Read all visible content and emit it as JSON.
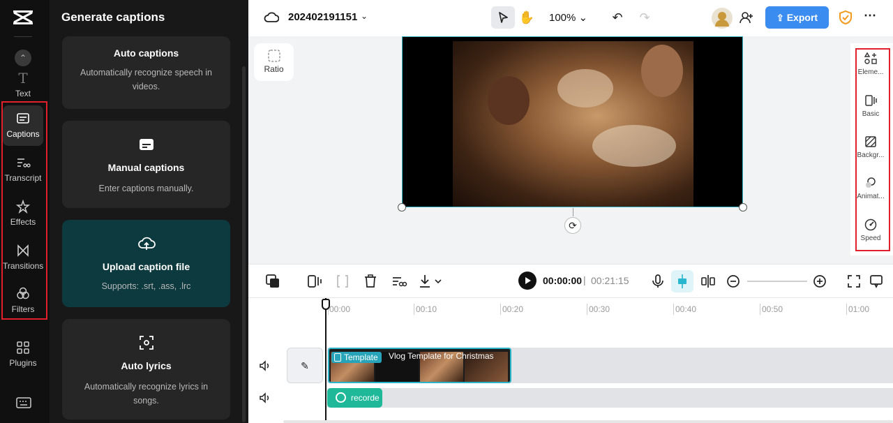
{
  "left_rail": {
    "items": [
      {
        "label": "Text"
      },
      {
        "label": "Captions"
      },
      {
        "label": "Transcript"
      },
      {
        "label": "Effects"
      },
      {
        "label": "Transitions"
      },
      {
        "label": "Filters"
      },
      {
        "label": "Plugins"
      }
    ]
  },
  "panel": {
    "title": "Generate captions",
    "cards": [
      {
        "title": "Auto captions",
        "desc": "Automatically recognize speech in videos."
      },
      {
        "title": "Manual captions",
        "desc": "Enter captions manually."
      },
      {
        "title": "Upload caption file",
        "desc": "Supports: .srt, .ass, .lrc"
      },
      {
        "title": "Auto lyrics",
        "desc": "Automatically recognize lyrics in songs."
      }
    ]
  },
  "topbar": {
    "project_name": "202402191151",
    "zoom": "100%",
    "export_label": "Export",
    "accent_color": "#3a8cf0"
  },
  "canvas": {
    "ratio_label": "Ratio"
  },
  "props": {
    "items": [
      {
        "label": "Eleme...",
        "icon": "elements-icon"
      },
      {
        "label": "Basic",
        "icon": "basic-icon"
      },
      {
        "label": "Backgr...",
        "icon": "background-icon"
      },
      {
        "label": "Animat...",
        "icon": "animation-icon"
      },
      {
        "label": "Speed",
        "icon": "speed-icon"
      }
    ]
  },
  "player": {
    "current_time": "00:00:00",
    "separator": "|",
    "duration": "00:21:15"
  },
  "timeline": {
    "ticks": [
      "00:00",
      "00:10",
      "00:20",
      "00:30",
      "00:40",
      "00:50",
      "01:00"
    ],
    "video_clip": {
      "tag": "Template",
      "name": "Vlog Template for Christmas"
    },
    "audio_clip": {
      "name": "recorde"
    }
  }
}
